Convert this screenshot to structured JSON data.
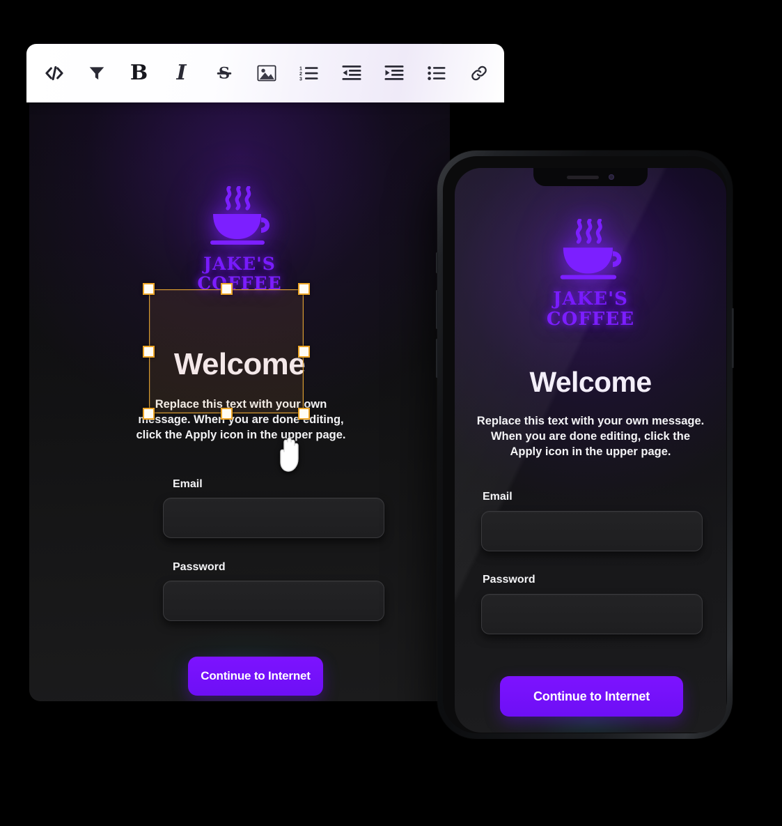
{
  "editor": {
    "toolbar": {
      "name": "rich-text-toolbar",
      "items": [
        {
          "icon": "code-icon",
          "label": "Source code"
        },
        {
          "icon": "filter-icon",
          "label": "Format / Filter"
        },
        {
          "icon": "bold-icon",
          "label": "Bold"
        },
        {
          "icon": "italic-icon",
          "label": "Italic"
        },
        {
          "icon": "strikethrough-icon",
          "label": "Strikethrough"
        },
        {
          "icon": "image-icon",
          "label": "Insert image"
        },
        {
          "icon": "ordered-list-icon",
          "label": "Numbered list"
        },
        {
          "icon": "outdent-icon",
          "label": "Decrease indent"
        },
        {
          "icon": "indent-icon",
          "label": "Increase indent"
        },
        {
          "icon": "unordered-list-icon",
          "label": "Bulleted list"
        },
        {
          "icon": "link-icon",
          "label": "Insert link"
        }
      ]
    },
    "selection": {
      "name": "text-block-selection",
      "handle_count": 8,
      "border_color": "#eda629",
      "handle_fill": "#fffdf6",
      "cursor": "grab-hand-cursor"
    }
  },
  "brand": {
    "logo_name": "jakes-coffee-logo",
    "line1": "JAKE'S",
    "line2": "COFFEE",
    "glow_color": "#7c1fff"
  },
  "desktop_preview": {
    "headline": "Welcome",
    "body": "Replace this text with your own message. When you are done editing, click the Apply icon in the upper page.",
    "email_label": "Email",
    "email_value": "",
    "email_placeholder": "",
    "password_label": "Password",
    "password_value": "",
    "password_placeholder": "",
    "cta_label": "Continue to Internet"
  },
  "phone_preview": {
    "device": "smartphone-mockup",
    "headline": "Welcome",
    "body": "Replace this text with your own message. When you are done editing, click the Apply icon in the upper page.",
    "email_label": "Email",
    "email_value": "",
    "email_placeholder": "",
    "password_label": "Password",
    "password_value": "",
    "password_placeholder": "",
    "cta_label": "Continue to Internet"
  },
  "theme": {
    "accent": "#7d13ff",
    "background": "#000000",
    "panel": "#141416",
    "text": "#f3eef9",
    "selection_accent": "#eda629"
  }
}
